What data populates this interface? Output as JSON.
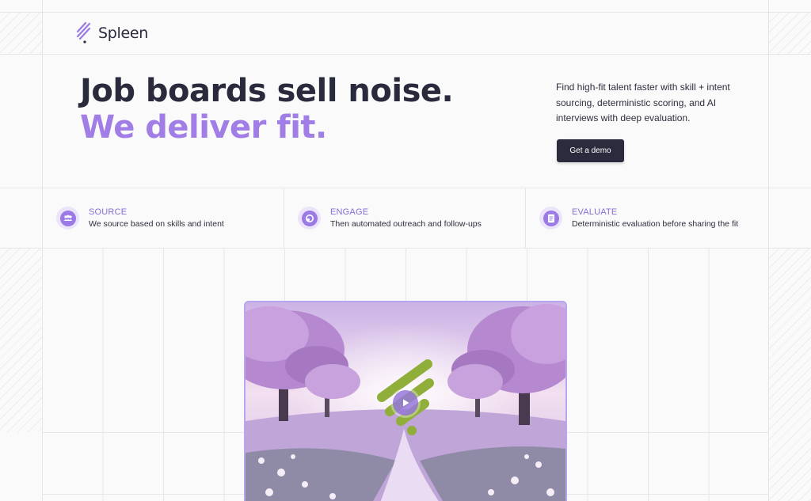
{
  "brand": {
    "name": "Spleen",
    "accent": "#a07ee6",
    "dark": "#2b2b3d"
  },
  "hero": {
    "title_line1": "Job boards sell noise.",
    "title_line2": "We deliver fit.",
    "description": "Find high-fit talent faster with skill + intent sourcing, deterministic scoring, and AI interviews with deep evaluation.",
    "cta_label": "Get a demo"
  },
  "features": [
    {
      "icon": "users-icon",
      "title": "SOURCE",
      "description": "We source based on skills and intent"
    },
    {
      "icon": "chat-icon",
      "title": "ENGAGE",
      "description": "Then automated outreach and follow-ups"
    },
    {
      "icon": "document-icon",
      "title": "EVALUATE",
      "description": "Deterministic evaluation before sharing the fit"
    }
  ],
  "video": {
    "icon": "play-icon"
  }
}
